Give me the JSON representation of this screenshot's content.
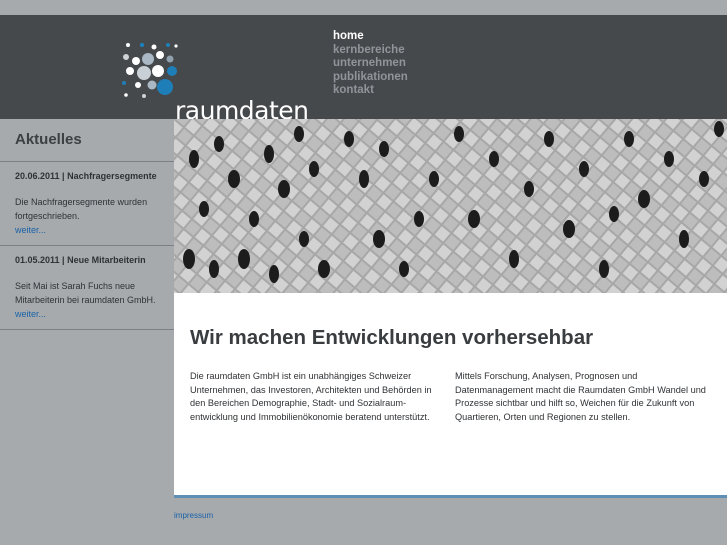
{
  "brand": {
    "name": "raumdaten"
  },
  "nav": {
    "items": [
      {
        "label": "home",
        "active": true
      },
      {
        "label": "kernbereiche",
        "active": false
      },
      {
        "label": "unternehmen",
        "active": false
      },
      {
        "label": "publikationen",
        "active": false
      },
      {
        "label": "kontakt",
        "active": false
      }
    ]
  },
  "sidebar": {
    "title": "Aktuelles",
    "news": [
      {
        "heading": "20.06.2011 | Nachfragersegmente",
        "body": "Die Nachfragersegmente wurden fortgeschrieben.",
        "link": "weiter..."
      },
      {
        "heading": "01.05.2011 | Neue Mitarbeiterin",
        "body": "Seit Mai ist Sarah Fuchs neue Mitarbeiterin bei raumdaten GmbH.",
        "link": "weiter..."
      }
    ]
  },
  "main": {
    "headline": "Wir machen Entwicklungen vorhersehbar",
    "col1": "Die raumdaten GmbH ist ein unabhängiges Schweizer Unternehmen, das Investoren, Architekten und Behörden in den Bereichen Demographie, Stadt- und Sozialraum-entwicklung und Immobilienökonomie beratend unterstützt.",
    "col2": "Mittels Forschung, Analysen,  Prognosen und Datenmanagement macht die Raumdaten GmbH Wandel und  Prozesse sichtbar und hilft so, Weichen für die Zukunft von Quartieren,  Orten und Regionen zu stellen."
  },
  "footer": {
    "link": "impressum"
  },
  "colors": {
    "header": "#46494c",
    "background": "#a6aaad",
    "link": "#1a62a8",
    "accent": "#5f8fb4"
  }
}
